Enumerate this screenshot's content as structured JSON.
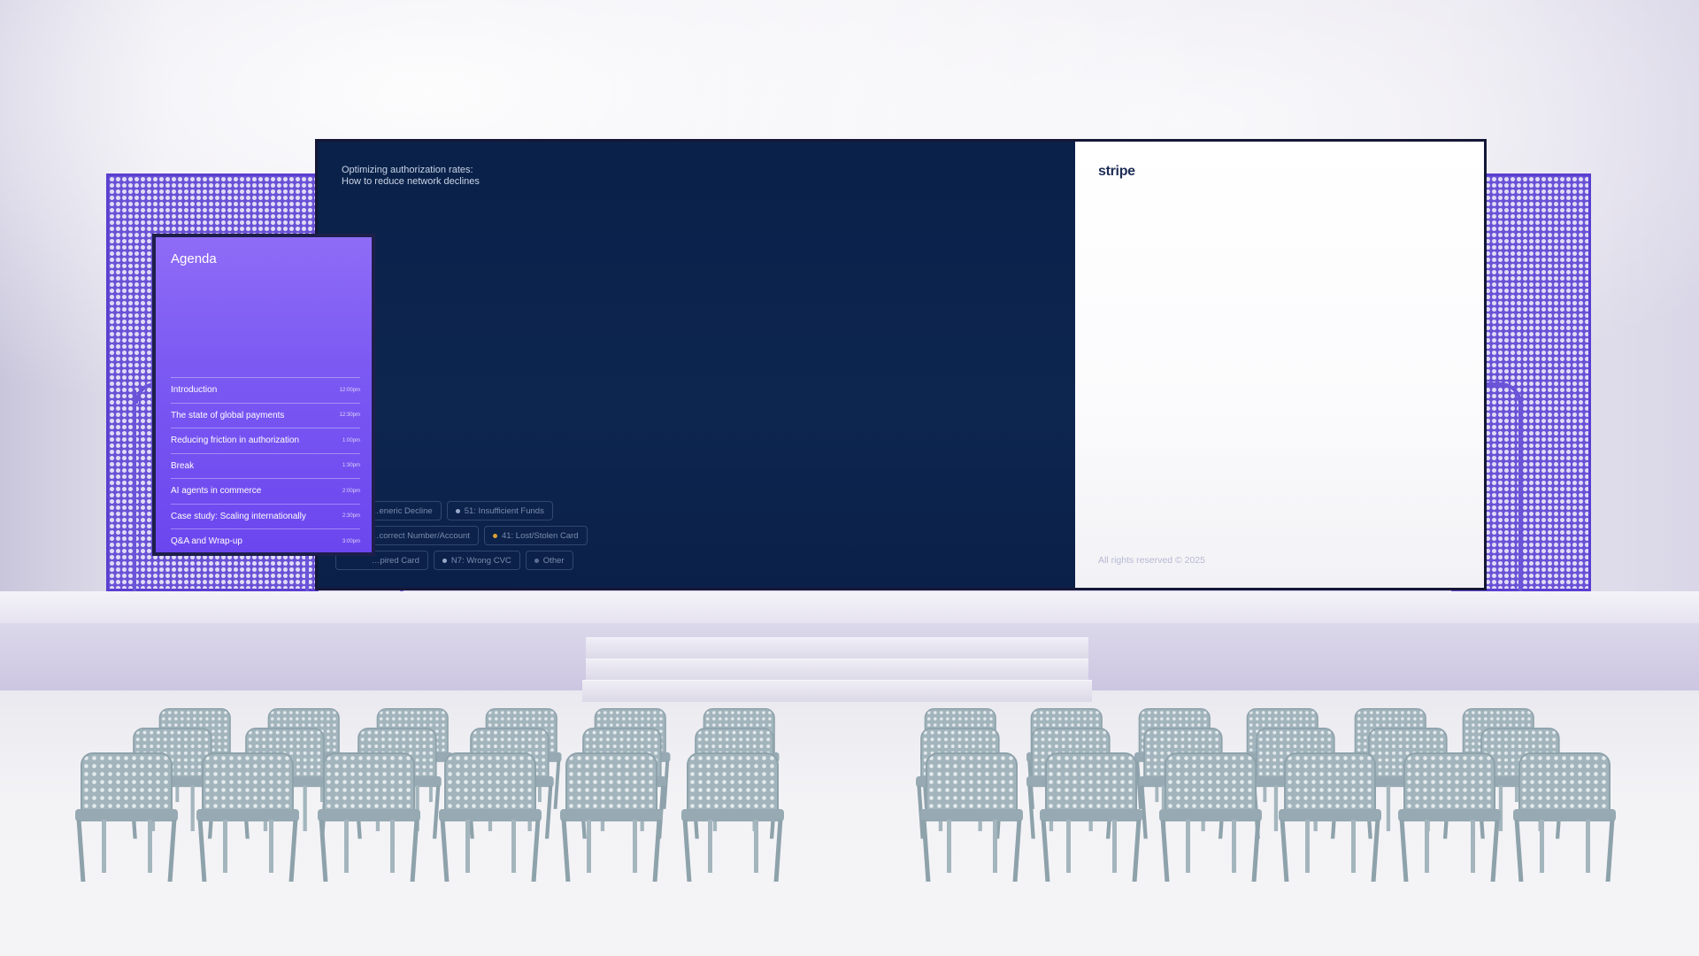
{
  "screen": {
    "slide_title_line1": "Optimizing authorization rates:",
    "slide_title_line2": "How to reduce network declines",
    "chips": [
      {
        "label": "…eneric Decline",
        "color": "#7a8bad"
      },
      {
        "label": "51: Insufficient Funds",
        "color": "#9aa8c8"
      },
      {
        "label": "…correct Number/Account",
        "color": "#7a8bad"
      },
      {
        "label": "41: Lost/Stolen Card",
        "color": "#d9a233"
      },
      {
        "label": "…pired Card",
        "color": "#7a8bad"
      },
      {
        "label": "N7: Wrong CVC",
        "color": "#9aa8c8"
      },
      {
        "label": "Other",
        "color": "#5d6e92"
      }
    ],
    "brand": "stripe",
    "copyright": "All rights reserved © 2025"
  },
  "agenda": {
    "title": "Agenda",
    "items": [
      {
        "label": "Introduction",
        "time": "12:00pm"
      },
      {
        "label": "The state of global payments",
        "time": "12:30pm"
      },
      {
        "label": "Reducing friction in authorization",
        "time": "1:00pm"
      },
      {
        "label": "Break",
        "time": "1:30pm"
      },
      {
        "label": "AI agents in commerce",
        "time": "2:00pm"
      },
      {
        "label": "Case study: Scaling internationally",
        "time": "2:30pm"
      },
      {
        "label": "Q&A and Wrap-up",
        "time": "3:00pm"
      }
    ]
  },
  "colors": {
    "accent": "#6b46ef",
    "screen_bg": "#0a2149",
    "chair": "#a2b4bc"
  }
}
